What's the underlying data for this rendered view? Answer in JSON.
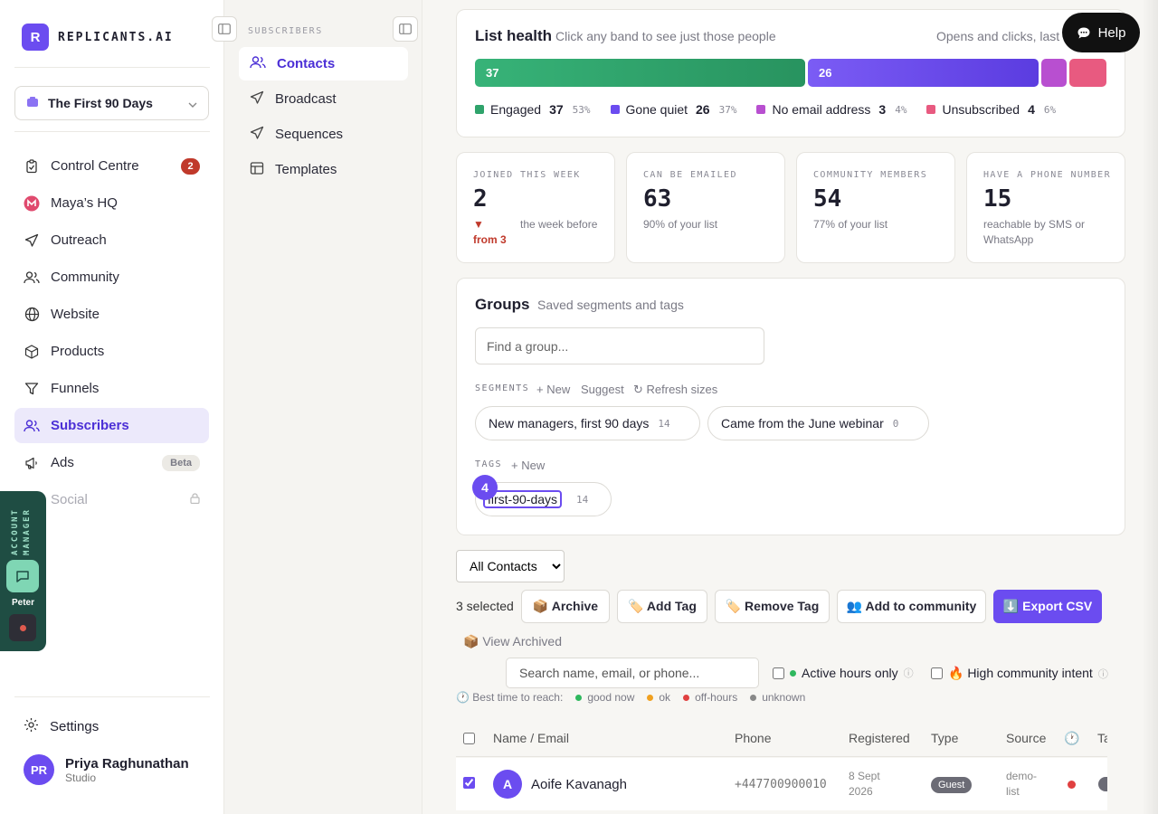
{
  "brand": {
    "logo_letter": "R",
    "name": "REPLICANTS.AI"
  },
  "workspace": {
    "name": "The First 90 Days"
  },
  "nav": {
    "items": [
      {
        "label": "Control Centre",
        "icon": "clipboard-icon",
        "badge": "2"
      },
      {
        "label": "Maya’s HQ",
        "icon": "maya-logo-icon"
      },
      {
        "label": "Outreach",
        "icon": "send-icon"
      },
      {
        "label": "Community",
        "icon": "people-icon"
      },
      {
        "label": "Website",
        "icon": "globe-icon"
      },
      {
        "label": "Products",
        "icon": "box-icon"
      },
      {
        "label": "Funnels",
        "icon": "funnel-icon"
      },
      {
        "label": "Subscribers",
        "icon": "people-icon",
        "active": true
      },
      {
        "label": "Ads",
        "icon": "megaphone-icon",
        "badge": "Beta"
      },
      {
        "label": "Social",
        "icon": "share-icon",
        "locked": true
      }
    ],
    "settings_label": "Settings"
  },
  "user": {
    "initials": "PR",
    "name": "Priya Raghunathan",
    "role": "Studio"
  },
  "account_manager": {
    "label": "ACCOUNT MANAGER",
    "name": "Peter"
  },
  "subnav": {
    "title": "SUBSCRIBERS",
    "items": [
      {
        "label": "Contacts",
        "icon": "people-icon",
        "active": true
      },
      {
        "label": "Broadcast",
        "icon": "send-icon"
      },
      {
        "label": "Sequences",
        "icon": "send-icon"
      },
      {
        "label": "Templates",
        "icon": "layout-icon"
      }
    ]
  },
  "help": {
    "label": "Help"
  },
  "list_health": {
    "title": "List health",
    "subtitle": "Click any band to see just those people",
    "right_text": "Opens and clicks, last",
    "bands": [
      {
        "name": "Engaged",
        "count": "37",
        "pct": "53%",
        "share": 0.53,
        "color": "#2fa36b",
        "show_label": true
      },
      {
        "name": "Gone quiet",
        "count": "26",
        "pct": "37%",
        "share": 0.37,
        "color": "#6b4cf0",
        "show_label": true
      },
      {
        "name": "No email address",
        "count": "3",
        "pct": "4%",
        "share": 0.04,
        "color": "#b84fd0",
        "show_label": false
      },
      {
        "name": "Unsubscribed",
        "count": "4",
        "pct": "6%",
        "share": 0.06,
        "color": "#e85a80",
        "show_label": false
      }
    ]
  },
  "stats": [
    {
      "label": "JOINED THIS WEEK",
      "value": "2",
      "delta": "▼ from 3",
      "sub": "the week before"
    },
    {
      "label": "CAN BE EMAILED",
      "value": "63",
      "sub": "90% of your list"
    },
    {
      "label": "COMMUNITY MEMBERS",
      "value": "54",
      "sub": "77% of your list"
    },
    {
      "label": "HAVE A PHONE NUMBER",
      "value": "15",
      "sub": "reachable by SMS or WhatsApp"
    }
  ],
  "groups": {
    "title": "Groups",
    "subtitle": "Saved segments and tags",
    "search_placeholder": "Find a group...",
    "segments_label": "SEGMENTS",
    "new_label": "+ New",
    "suggest_label": "Suggest",
    "refresh_label": "↻ Refresh sizes",
    "segments": [
      {
        "name": "New managers, first 90 days",
        "count": "14"
      },
      {
        "name": "Came from the June webinar",
        "count": "0"
      }
    ],
    "tags_label": "TAGS",
    "tags_new_label": "+ New",
    "tags": [
      {
        "name": "first-90-days",
        "count": "14"
      }
    ],
    "step_badge": "4"
  },
  "toolbar": {
    "view_select": "All Contacts",
    "selected_count": "3 selected",
    "archive": "📦 Archive",
    "add_tag": "🏷️ Add Tag",
    "remove_tag": "🏷️ Remove Tag",
    "add_community": "👥 Add to community",
    "export": "⬇️ Export CSV",
    "view_archived": "📦 View Archived",
    "search_placeholder": "Search name, email, or phone...",
    "active_hours": "Active hours only",
    "high_intent": "🔥 High community intent"
  },
  "reach_legend": {
    "label": "🕐 Best time to reach:",
    "items": [
      {
        "label": "good now",
        "color": "#2fb85e"
      },
      {
        "label": "ok",
        "color": "#f0a020"
      },
      {
        "label": "off-hours",
        "color": "#e04040"
      },
      {
        "label": "unknown",
        "color": "#888888"
      }
    ]
  },
  "table": {
    "columns": [
      "Name / Email",
      "Phone",
      "Registered",
      "Type",
      "Source",
      "🕐",
      "Ta"
    ],
    "rows": [
      {
        "initial": "A",
        "name": "Aoife Kavanagh",
        "phone": "+447700900010",
        "registered_line1": "8 Sept",
        "registered_line2": "2026",
        "type": "Guest",
        "source_line1": "demo-",
        "source_line2": "list",
        "checked": true,
        "reach_color": "#e04040"
      }
    ]
  }
}
